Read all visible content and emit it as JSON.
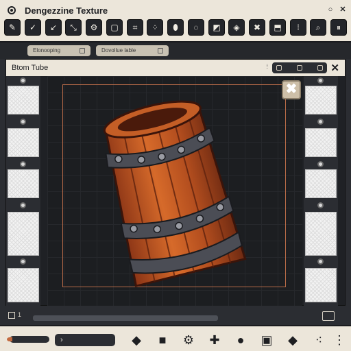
{
  "window": {
    "title": "Dengezzine Texture",
    "controls": [
      "minimize",
      "close"
    ]
  },
  "toolbar": {
    "buttons": [
      {
        "name": "edit-icon",
        "glyph": "✎"
      },
      {
        "name": "check-icon",
        "glyph": "✓"
      },
      {
        "name": "export-icon",
        "glyph": "↙"
      },
      {
        "name": "transform-icon",
        "glyph": "⤡"
      },
      {
        "name": "gear-icon",
        "glyph": "⚙"
      },
      {
        "name": "select-icon",
        "glyph": "▢"
      },
      {
        "name": "crop-icon",
        "glyph": "⌗"
      },
      {
        "name": "dice-icon",
        "glyph": "⁘"
      },
      {
        "name": "capsule-icon",
        "glyph": "⬮"
      },
      {
        "name": "lasso-icon",
        "glyph": "◌"
      },
      {
        "name": "layer-icon",
        "glyph": "◩"
      },
      {
        "name": "node-icon",
        "glyph": "◈"
      },
      {
        "name": "cross-icon",
        "glyph": "✖"
      },
      {
        "name": "cube-icon",
        "glyph": "⬒"
      },
      {
        "name": "grid-icon",
        "glyph": "⁞"
      },
      {
        "name": "search-icon",
        "glyph": "⌕"
      },
      {
        "name": "pause-icon",
        "glyph": "⏸"
      }
    ]
  },
  "tabs": [
    {
      "label": "Elonooping"
    },
    {
      "label": "Dovollue lable"
    }
  ],
  "panel": {
    "title": "Btom Tube",
    "close_glyph": "✕",
    "pin_glyph": "⁞"
  },
  "canvas": {
    "close_glyph": "✖"
  },
  "status": {
    "count": "1"
  },
  "bottom": {
    "dropdown_glyph": "›",
    "tools": [
      {
        "name": "small-diamond-icon",
        "glyph": "◆"
      },
      {
        "name": "square-icon",
        "glyph": "■"
      },
      {
        "name": "gear-icon",
        "glyph": "⚙"
      },
      {
        "name": "cross-cog-icon",
        "glyph": "✚"
      },
      {
        "name": "bomb-icon",
        "glyph": "●"
      },
      {
        "name": "grid-box-icon",
        "glyph": "▣"
      },
      {
        "name": "diamond-icon",
        "glyph": "◆"
      },
      {
        "name": "scatter-icon",
        "glyph": "⁖"
      },
      {
        "name": "dots-icon",
        "glyph": "⋮"
      }
    ]
  },
  "colors": {
    "accent": "#c36a3f",
    "panel_light": "#ece6da",
    "dark": "#2b2d32"
  }
}
